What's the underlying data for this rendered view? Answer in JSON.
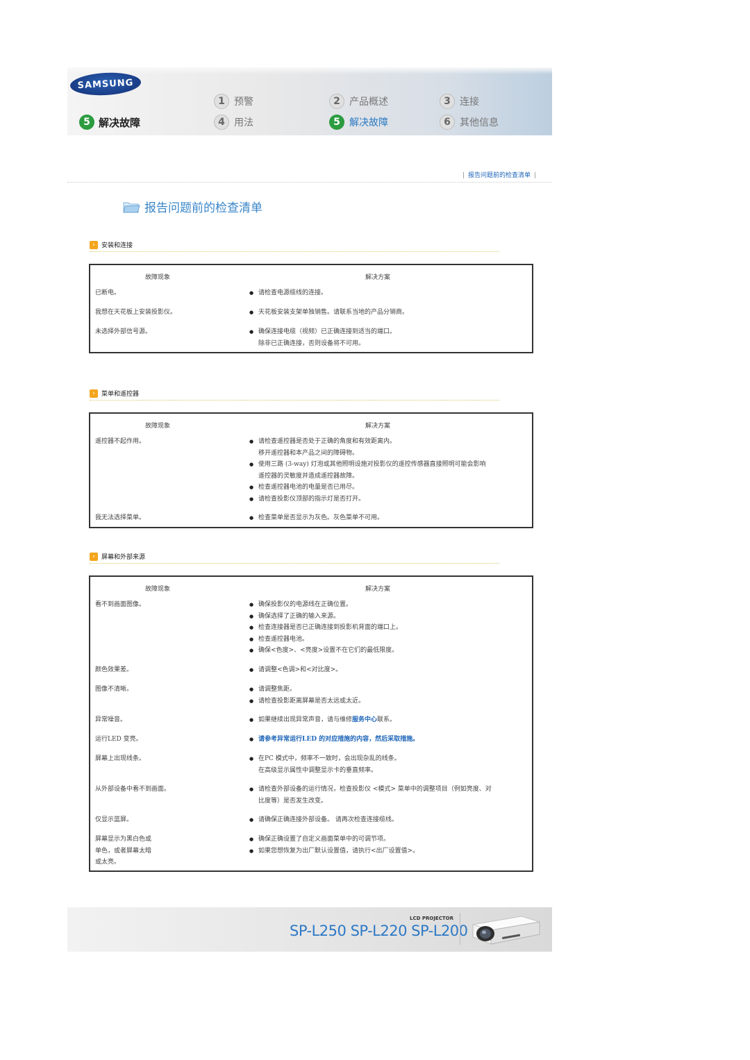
{
  "header": {
    "brand": "SAMSUNG",
    "section_number": "5",
    "section_title": "解决故障",
    "nav": [
      {
        "number": "1",
        "label": "预警"
      },
      {
        "number": "2",
        "label": "产品概述"
      },
      {
        "number": "3",
        "label": "连接"
      },
      {
        "number": "4",
        "label": "用法"
      },
      {
        "number": "5",
        "label": "解决故障"
      },
      {
        "number": "6",
        "label": "其他信息"
      }
    ]
  },
  "breadcrumb": "报告问题前的检查清单",
  "page_title": "报告问题前的检查清单",
  "columns": {
    "symptom": "故障现象",
    "solution": "解决方案"
  },
  "sections": [
    {
      "title": "安装和连接",
      "rows": [
        {
          "symptom": "已断电。",
          "items": [
            "请检查电源缆线的连接。"
          ]
        },
        {
          "symptom": "我想在天花板上安装投影仪。",
          "items": [
            "天花板安装支架单独销售。请联系当地的产品分销商。"
          ]
        },
        {
          "symptom": "未选择外部信号源。",
          "items": [
            "确保连接电缆（视频）已正确连接到适当的端口。"
          ],
          "cont": "除非已正确连接，否则设备将不可用。"
        }
      ]
    },
    {
      "title": "菜单和遥控器",
      "rows": [
        {
          "symptom": "遥控器不起作用。",
          "item1": "请检查遥控器是否处于正确的角度和有效距离内。",
          "item1_cont": "移开遥控器和本产品之间的障碍物。",
          "item2": "使用三路 (3-way) 灯泡或其他照明设施对投影仪的遥控传感器直接照明可能会影响",
          "item2_cont": "遥控器的灵敏度并造成遥控器故障。",
          "item3": "检查遥控器电池的电量是否已用尽。",
          "item4": "请检查投影仪顶部的指示灯是否打开。"
        },
        {
          "symptom": "我无法选择菜单。",
          "items": [
            "检查菜单是否显示为灰色。灰色菜单不可用。"
          ]
        }
      ]
    },
    {
      "title": "屏幕和外部来源",
      "rows": [
        {
          "symptom": "看不到画面图像。",
          "items": [
            "确保投影仪的电源线在正确位置。",
            "确保选择了正确的输入来源。",
            "检查连接器是否已正确连接到投影机背面的端口上。",
            "检查遥控器电池。",
            "确保<色度>、<亮度>设置不在它们的最低限度。"
          ]
        },
        {
          "symptom": "颜色效果差。",
          "items": [
            "请调整<色调>和<对比度>。"
          ]
        },
        {
          "symptom": "图像不清晰。",
          "items": [
            "请调整焦距。",
            "请检查投影距离屏幕是否太远或太近。"
          ]
        },
        {
          "symptom": "异常噪音。",
          "pre": "如果继续出现异常声音，请与维修",
          "link": "服务中心",
          "post": "联系。"
        },
        {
          "symptom": "运行LED 变亮。",
          "items": [
            "请参考异常运行LED 的对应措施的内容，然后采取措施。"
          ]
        },
        {
          "symptom": "屏幕上出现线条。",
          "items": [
            "在PC 模式中，频率不一致时，会出现杂乱的线条。"
          ],
          "cont": "在高级显示属性中调整显示卡的垂直频率。"
        },
        {
          "symptom": "从外部设备中看不到画面。",
          "items": [
            "请检查外部设备的运行情况，检查投影仪 <模式> 菜单中的调整项目（例如亮度、对"
          ],
          "cont": "比度等）是否发生改变。"
        },
        {
          "symptom": "仅显示蓝屏。",
          "items": [
            "请确保正确连接外部设备。 请再次检查连接缆线。"
          ]
        },
        {
          "symptom_lines": [
            "屏幕显示为黑白色或",
            "单色，或者屏幕太暗",
            "或太亮。"
          ],
          "items": [
            "确保正确设置了自定义画面菜单中的可调节项。",
            "如果您想恢复为出厂默认设置值，请执行<出厂设置值>。"
          ]
        }
      ]
    }
  ],
  "footer": {
    "product_type": "LCD PROJECTOR",
    "models": "SP-L250 SP-L220 SP-L200"
  },
  "colors": {
    "accent_blue": "#1f66b9",
    "active_green": "#2b9c3f",
    "section_arrow": "#f4a51c"
  }
}
